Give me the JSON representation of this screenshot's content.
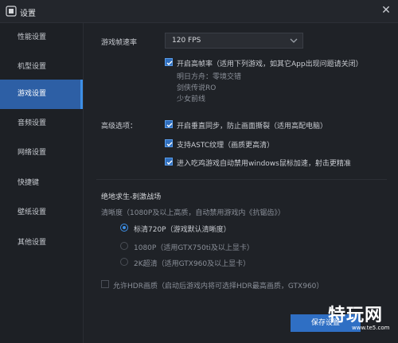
{
  "window": {
    "title": "设置",
    "close_icon": "close-icon"
  },
  "sidebar": {
    "items": [
      {
        "label": "性能设置"
      },
      {
        "label": "机型设置"
      },
      {
        "label": "游戏设置",
        "active": true
      },
      {
        "label": "音频设置"
      },
      {
        "label": "网络设置"
      },
      {
        "label": "快捷键"
      },
      {
        "label": "壁纸设置"
      },
      {
        "label": "其他设置"
      }
    ]
  },
  "game": {
    "fps_label": "游戏帧速率",
    "fps_value": "120 FPS",
    "high_fps": {
      "label": "开启高帧率（适用下列游戏，如其它App出现问题请关闭）",
      "checked": true,
      "games": [
        "明日方舟：零境交错",
        "剑侠传说RO",
        "少女前线"
      ]
    },
    "advanced_label": "高级选项：",
    "advanced": [
      {
        "label": "开启垂直同步，防止画面撕裂（适用高配电脑）",
        "checked": true
      },
      {
        "label": "支持ASTC纹理（画质更高清）",
        "checked": true
      },
      {
        "label": "进入吃鸡游戏自动禁用windows鼠标加速，射击更精准",
        "checked": true
      }
    ]
  },
  "pubg": {
    "title": "绝地求生-刺激战场",
    "resolution_label": "清晰度（1080P及以上高质，自动禁用游戏内《抗锯齿》）",
    "options": [
      {
        "label": "标清720P（游戏默认清晰度）",
        "selected": true
      },
      {
        "label": "1080P（适用GTX750ti及以上显卡）",
        "selected": false
      },
      {
        "label": "2K超清（适用GTX960及以上显卡）",
        "selected": false
      }
    ],
    "hdr_label": "允许HDR画质（启动后游戏内将可选择HDR最高画质，GTX960）",
    "hdr_checked": false
  },
  "footer": {
    "save_label": "保存设置"
  },
  "watermark": {
    "text": "特玩网",
    "url": "www.te5.com"
  },
  "colors": {
    "accent": "#2f6fc4",
    "active_nav": "#2d5fa5",
    "bg": "#1f2227"
  }
}
